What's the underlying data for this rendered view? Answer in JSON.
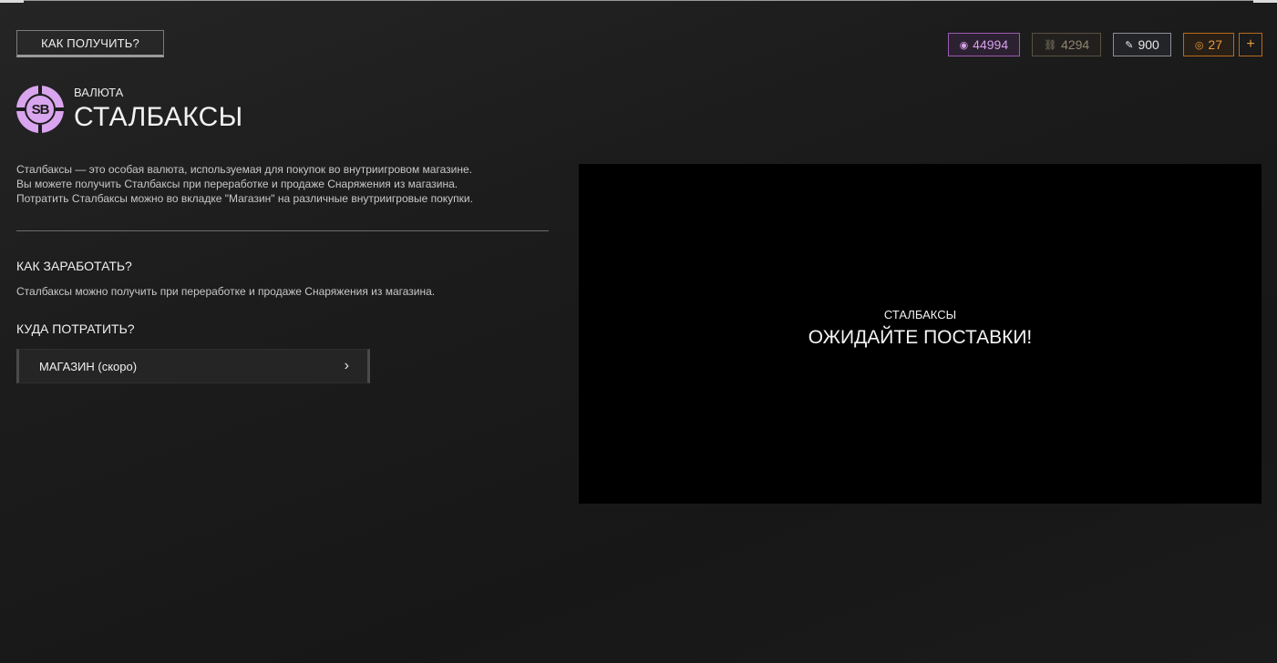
{
  "header": {
    "how_to_get_label": "КАК ПОЛУЧИТЬ?"
  },
  "currencies": [
    {
      "name": "stalbucks",
      "icon": "sb-coin-icon",
      "value": "44994",
      "color": "#d7a1ea"
    },
    {
      "name": "parts",
      "icon": "chain-link-icon",
      "value": "4294",
      "color": "#8e8470"
    },
    {
      "name": "tickets",
      "icon": "ticket-icon",
      "value": "900",
      "color": "#e8e8e8"
    },
    {
      "name": "coins",
      "icon": "sc-coin-icon",
      "value": "27",
      "color": "#e89a3c"
    }
  ],
  "add_currency_label": "+",
  "item": {
    "category": "ВАЛЮТА",
    "title": "СТАЛБАКСЫ",
    "icon_text": "SB",
    "icon_color": "#d9a5ee",
    "description_lines": [
      "Сталбаксы — это особая валюта, используемая для покупок во внутриигровом магазине.",
      "Вы можете получить Сталбаксы при переработке и продаже Снаряжения из магазина.",
      "Потратить Сталбаксы можно во вкладке \"Магазин\" на различные внутриигровые покупки."
    ]
  },
  "earn": {
    "heading": "КАК ЗАРАБОТАТЬ?",
    "text": "Сталбаксы можно получить при переработке и продаже Снаряжения из магазина."
  },
  "spend": {
    "heading": "КУДА ПОТРАТИТЬ?",
    "items": [
      {
        "label": "МАГАЗИН (скоро)",
        "chevron": "›"
      }
    ]
  },
  "preview": {
    "subtitle": "СТАЛБАКСЫ",
    "title": "ОЖИДАЙТЕ ПОСТАВКИ!"
  }
}
